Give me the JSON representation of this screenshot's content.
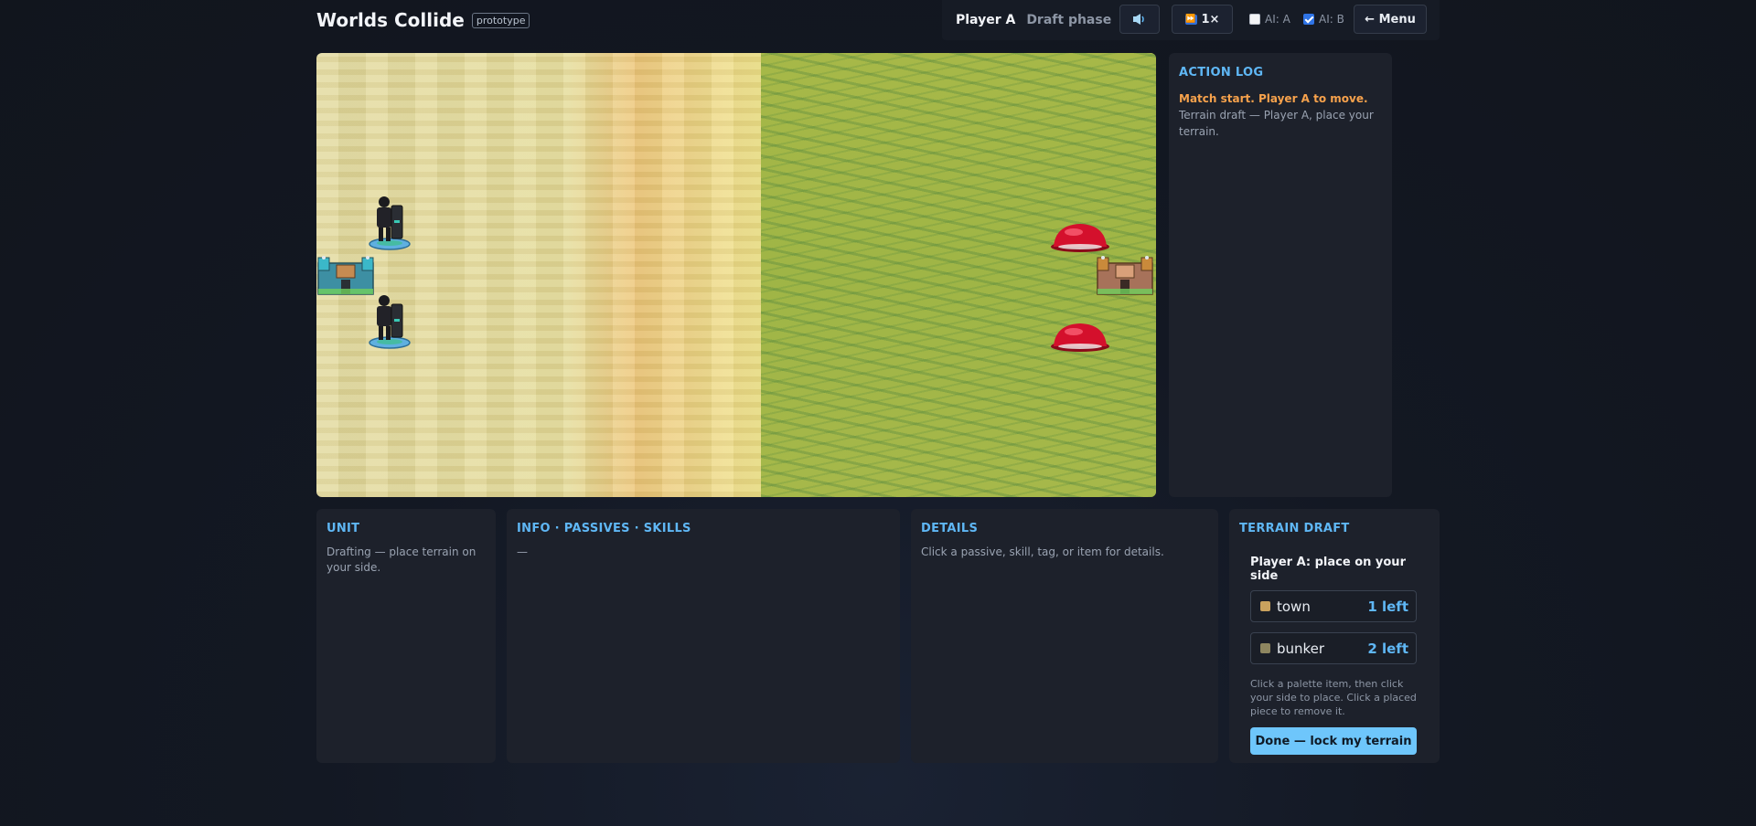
{
  "header": {
    "title": "Worlds Collide",
    "badge": "prototype"
  },
  "topbar": {
    "player": "Player A",
    "phase": "Draft phase",
    "sound_icon": "speaker-icon",
    "speed_label": "1×",
    "speed_icon": "fast-forward-icon",
    "ai_a": {
      "label": "AI: A",
      "checked": false
    },
    "ai_b": {
      "label": "AI: B",
      "checked": true
    },
    "menu_label": "← Menu"
  },
  "board": {
    "terrain_left": "desert",
    "terrain_right": "grassland",
    "pieces": [
      {
        "type": "soldier-icon",
        "side": "A",
        "ring": "#5fb0e0"
      },
      {
        "type": "soldier-icon",
        "side": "A",
        "ring": "#5fb0e0"
      },
      {
        "type": "fortress-icon",
        "side": "A",
        "accent": "#3bb8c9"
      },
      {
        "type": "dome-icon",
        "side": "B",
        "color": "#d4102c"
      },
      {
        "type": "dome-icon",
        "side": "B",
        "color": "#d4102c"
      },
      {
        "type": "fortress-icon",
        "side": "B",
        "accent": "#c98a3b"
      }
    ]
  },
  "action_log": {
    "title": "ACTION LOG",
    "highlight": "Match start. Player A to move.",
    "entry": "Terrain draft — Player A, place your terrain."
  },
  "unit_panel": {
    "title": "UNIT",
    "text": "Drafting — place terrain on your side."
  },
  "info_panel": {
    "title": "INFO · PASSIVES · SKILLS",
    "text": "—"
  },
  "details_panel": {
    "title": "DETAILS",
    "text": "Click a passive, skill, tag, or item for details."
  },
  "terrain_draft": {
    "title": "TERRAIN DRAFT",
    "prompt": "Player A: place on your side",
    "items": [
      {
        "name": "town",
        "count": "1 left",
        "color": "#c9a25e"
      },
      {
        "name": "bunker",
        "count": "2 left",
        "color": "#8e8660"
      }
    ],
    "hint": "Click a palette item, then click your side to place. Click a placed piece to remove it.",
    "button_label": "Done — lock my terrain"
  },
  "colors": {
    "accent": "#5fb7f5",
    "highlight": "#f7a24c",
    "button": "#6ec6fb"
  }
}
